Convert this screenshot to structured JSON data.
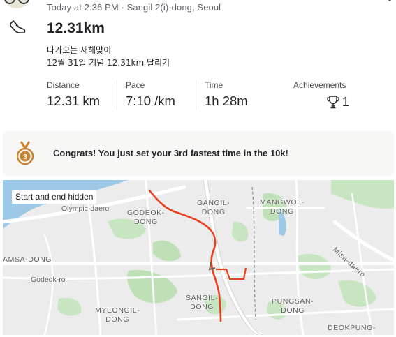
{
  "activity": {
    "meta": "Today at 2:36 PM · Sangil 2(i)-dong, Seoul",
    "title": "12.31km",
    "description_line1": "다가오는 새해맞이",
    "description_line2": "12월 31일 기념 12.31km 달리기"
  },
  "stats": {
    "distance_label": "Distance",
    "distance_value": "12.31 km",
    "pace_label": "Pace",
    "pace_value": "7:10 /km",
    "time_label": "Time",
    "time_value": "1h 28m",
    "achievements_label": "Achievements",
    "achievements_value": "1"
  },
  "banner": {
    "text": "Congrats! You just set your 3rd fastest time in the 10k!",
    "medal_number": "3"
  },
  "map": {
    "privacy_chip": "Start and end hidden",
    "labels": {
      "olympic": "Olympic-daero",
      "godeok_dong_1": "GODEOK-",
      "godeok_dong_2": "DONG",
      "gangil_1": "GANGIL-",
      "gangil_2": "DONG",
      "mangwol_1": "MANGWOL-",
      "mangwol_2": "DONG",
      "misa": "Misa-daero",
      "amsa": "AMSA-DONG",
      "godeok_ro": "Godeok-ro",
      "myeongil_1": "MYEONGIL-",
      "myeongil_2": "DONG",
      "sangil_1": "SANGIL-",
      "sangil_2": "DONG",
      "pungsan_1": "PUNGSAN-",
      "pungsan_2": "DONG",
      "deokpung": "DEOKPUNG-"
    }
  },
  "icons": {
    "activity_type": "shoe-icon",
    "achievement": "trophy-icon",
    "banner": "medal-icon"
  },
  "colors": {
    "route": "#e8401c",
    "medal": "#c9822f",
    "banner_bg": "#f7f7f5"
  }
}
